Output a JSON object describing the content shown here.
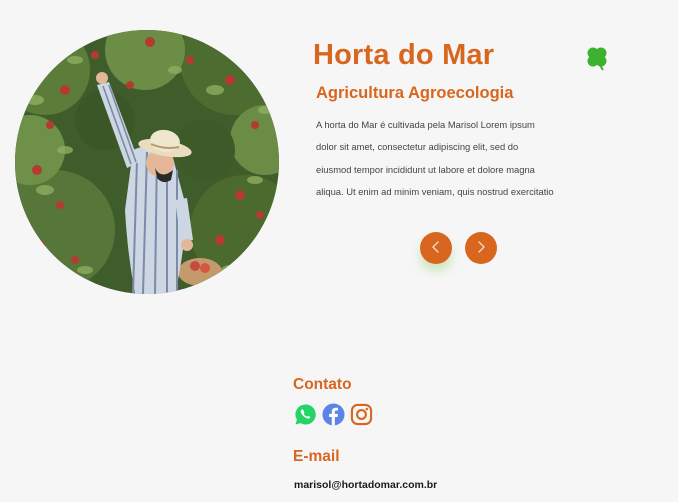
{
  "brand": {
    "title": "Horta do Mar",
    "icon": "four-leaf-clover-icon",
    "subtitle": "Agricultura Agroecologia",
    "description": "A horta do Mar é  cultivada pela Marisol Lorem ipsum\ndolor sit amet, consectetur adipiscing elit, sed do\neiusmod tempor incididunt ut labore et dolore magna\naliqua. Ut enim ad minim veniam, quis nostrud exercitatio"
  },
  "hero_image": {
    "alt": "Marisol colhendo maçãs na horta"
  },
  "carousel": {
    "prev_icon": "chevron-left-icon",
    "next_icon": "chevron-right-icon"
  },
  "contact": {
    "heading": "Contato",
    "social": [
      {
        "name": "whatsapp",
        "icon": "whatsapp-icon",
        "color": "#25d366"
      },
      {
        "name": "facebook",
        "icon": "facebook-icon",
        "color": "#5b83e8"
      },
      {
        "name": "instagram",
        "icon": "instagram-icon",
        "color": "#d9661f"
      }
    ]
  },
  "email": {
    "heading": "E-mail",
    "address": "marisol@hortadomar.com.br"
  },
  "colors": {
    "accent": "#d9661f",
    "clover": "#3db22e",
    "background": "#f6f6f6"
  }
}
